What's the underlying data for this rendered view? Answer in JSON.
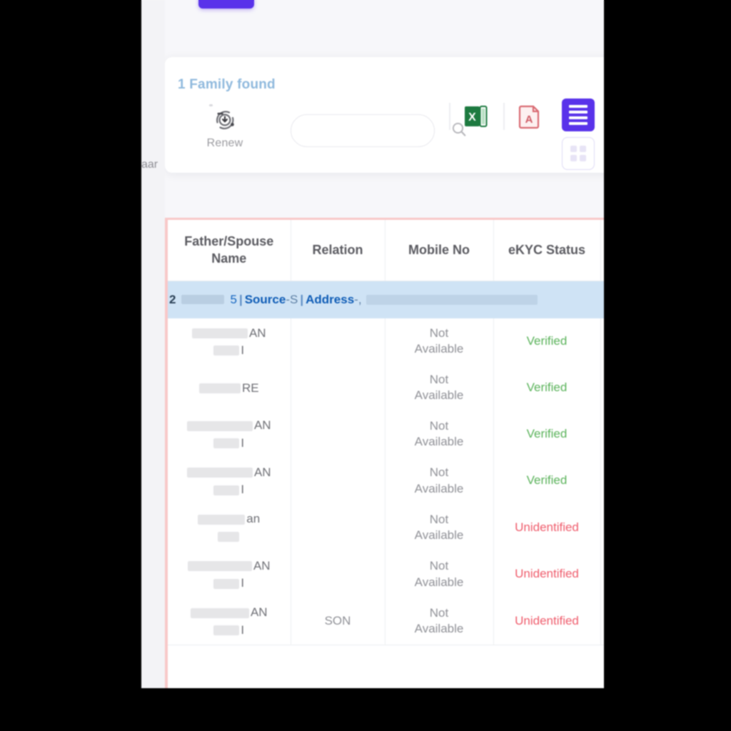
{
  "window": {
    "background_color": "#f7f7fa",
    "letterbox_color": "#000000"
  },
  "left_sliver": {
    "clipped_label": "aar"
  },
  "top_tab_stub": {
    "name": "purple-tab",
    "color": "#5932ea"
  },
  "results": {
    "count_label": "1 Family found",
    "count_color": "#8fb9dd"
  },
  "toolbar": {
    "renew": {
      "label": "Renew",
      "icon": "renew-download-icon"
    },
    "search": {
      "value": "",
      "placeholder": "",
      "icon": "search-icon"
    },
    "export_excel": {
      "label": "X",
      "icon": "excel-export-icon",
      "color": "#1d7a40"
    },
    "export_pdf": {
      "label": "A",
      "icon": "pdf-export-icon",
      "color": "#d96a72"
    },
    "view_list": {
      "icon": "list-view-icon",
      "active": "true",
      "color": "#5932ea"
    },
    "view_grid": {
      "icon": "grid-view-icon",
      "active": "false",
      "color": "#ddd9f5"
    }
  },
  "table": {
    "border_color": "#f8c8c8",
    "headers": [
      "Father/Spouse Name",
      "Relation",
      "Mobile No",
      "eKYC Status",
      ""
    ],
    "family_banner": {
      "id_fragment": "2",
      "name_fragment": "5",
      "source_label": "Source",
      "source_dash": "-",
      "source_value": "S",
      "address_label": "Address",
      "address_dash": "-",
      "address_value": ",",
      "pipe": "|",
      "highlight_color": "#cfe3f5",
      "text_color": "#1565c0"
    },
    "rows": [
      {
        "name_tail": "AN",
        "name_tail2": "I",
        "relation": "",
        "mobile": "Not Available",
        "ekyc": "Verified",
        "ekyc_state": "verified",
        "redact_w1": 78,
        "redact_w2": 36,
        "two_line": "true"
      },
      {
        "name_tail": "RE",
        "name_tail2": "",
        "relation": "",
        "mobile": "Not Available",
        "ekyc": "Verified",
        "ekyc_state": "verified",
        "redact_w1": 58,
        "redact_w2": 0,
        "two_line": "false"
      },
      {
        "name_tail": "AN",
        "name_tail2": "I",
        "relation": "",
        "mobile": "Not Available",
        "ekyc": "Verified",
        "ekyc_state": "verified",
        "redact_w1": 92,
        "redact_w2": 36,
        "two_line": "true"
      },
      {
        "name_tail": "AN",
        "name_tail2": "I",
        "relation": "",
        "mobile": "Not Available",
        "ekyc": "Verified",
        "ekyc_state": "verified",
        "redact_w1": 92,
        "redact_w2": 36,
        "two_line": "true"
      },
      {
        "name_tail": "an",
        "name_tail2": "",
        "relation": "",
        "mobile": "Not Available",
        "ekyc": "Unidentified",
        "ekyc_state": "unidentified",
        "redact_w1": 66,
        "redact_w2": 30,
        "two_line": "true"
      },
      {
        "name_tail": "AN",
        "name_tail2": "I",
        "relation": "",
        "mobile": "Not Available",
        "ekyc": "Unidentified",
        "ekyc_state": "unidentified",
        "redact_w1": 90,
        "redact_w2": 36,
        "two_line": "true"
      },
      {
        "name_tail": "AN",
        "name_tail2": "I",
        "relation": "SON",
        "mobile": "Not Available",
        "ekyc": "Unidentified",
        "ekyc_state": "unidentified",
        "redact_w1": 82,
        "redact_w2": 36,
        "two_line": "true"
      }
    ]
  },
  "colors": {
    "accent_purple": "#5932ea",
    "verified_green": "#59b259",
    "unidentified_red": "#ef5b6b",
    "link_blue": "#1565c0",
    "decor_orange": "#fbb06a"
  }
}
